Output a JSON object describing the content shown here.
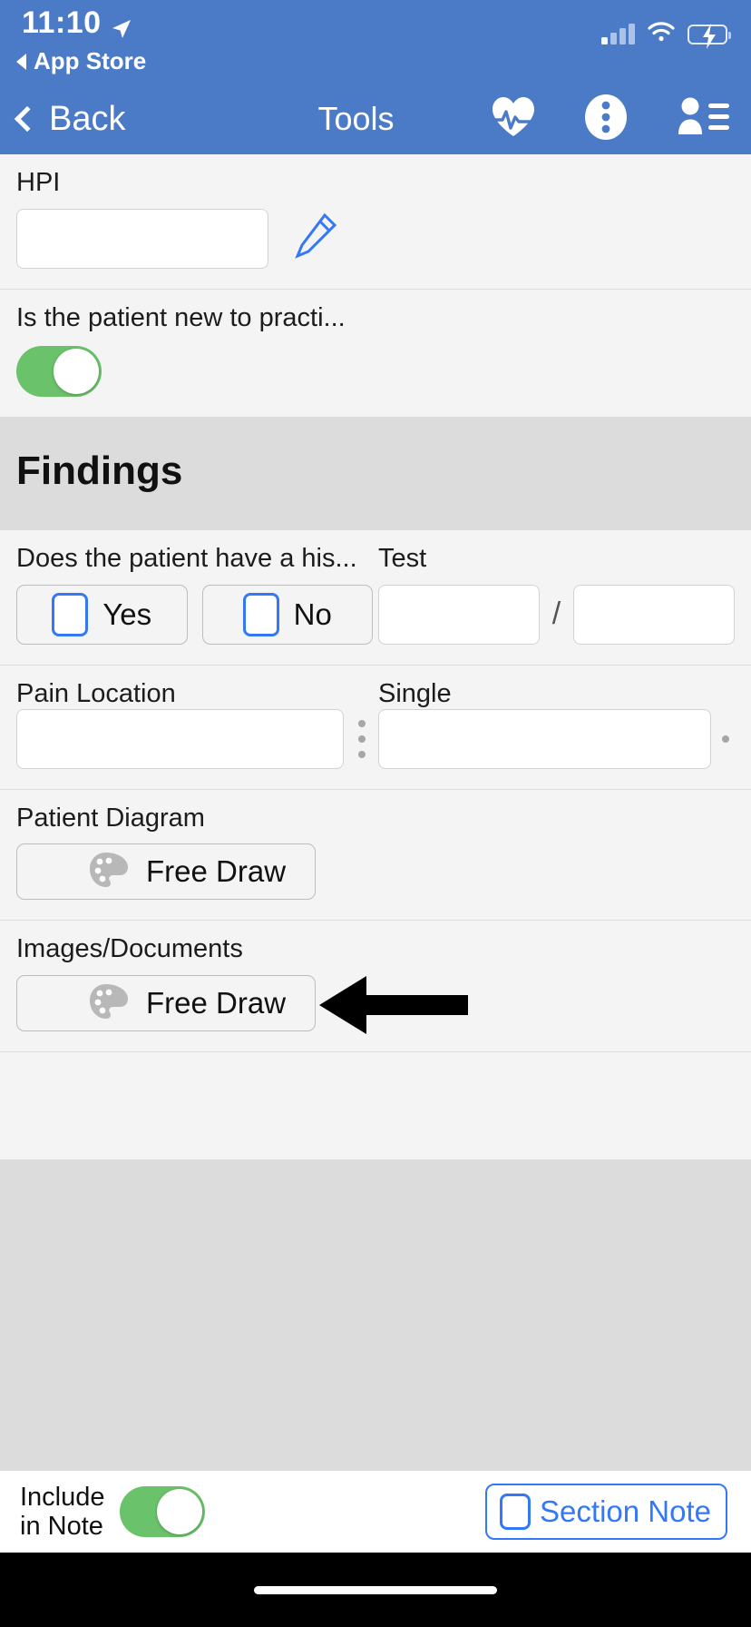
{
  "status_bar": {
    "time": "11:10",
    "location_icon": "location-arrow-icon",
    "back_app_label": "App Store",
    "signal_icon": "cellular-signal-icon",
    "wifi_icon": "wifi-icon",
    "battery_icon": "battery-charging-icon"
  },
  "nav_bar": {
    "back_label": "Back",
    "title": "Tools",
    "vitals_icon": "heart-pulse-icon",
    "more_icon": "more-vertical-icon",
    "patient_icon": "patient-list-icon"
  },
  "form": {
    "hpi": {
      "label": "HPI",
      "value": "",
      "edit_icon": "pencil-icon"
    },
    "patient_new": {
      "label": "Is the patient new to practi...",
      "toggle_on": true
    },
    "section_title": "Findings",
    "history_question": {
      "label": "Does the patient have a his...",
      "options": [
        {
          "label": "Yes",
          "checked": false
        },
        {
          "label": "No",
          "checked": false
        }
      ]
    },
    "test": {
      "label": "Test",
      "value_left": "",
      "value_right": "",
      "separator": "/"
    },
    "pain_location": {
      "label": "Pain Location",
      "value": "",
      "menu_icon": "vertical-dots-icon"
    },
    "single": {
      "label": "Single",
      "value": "",
      "menu_icon": "dot-icon"
    },
    "patient_diagram": {
      "label": "Patient Diagram",
      "button_label": "Free Draw",
      "button_icon": "palette-icon"
    },
    "images_documents": {
      "label": "Images/Documents",
      "button_label": "Free Draw",
      "button_icon": "palette-icon"
    }
  },
  "annotation": {
    "arrow_icon": "left-arrow-annotation"
  },
  "bottom_bar": {
    "include_line1": "Include",
    "include_line2": "in Note",
    "include_toggle_on": true,
    "section_note_label": "Section Note",
    "section_note_checked": false
  },
  "colors": {
    "nav_blue": "#4b7bc7",
    "toggle_green": "#6ac26a",
    "accent_blue": "#3478f6",
    "section_gray": "#dcdcdc",
    "card_gray": "#f4f4f4"
  }
}
